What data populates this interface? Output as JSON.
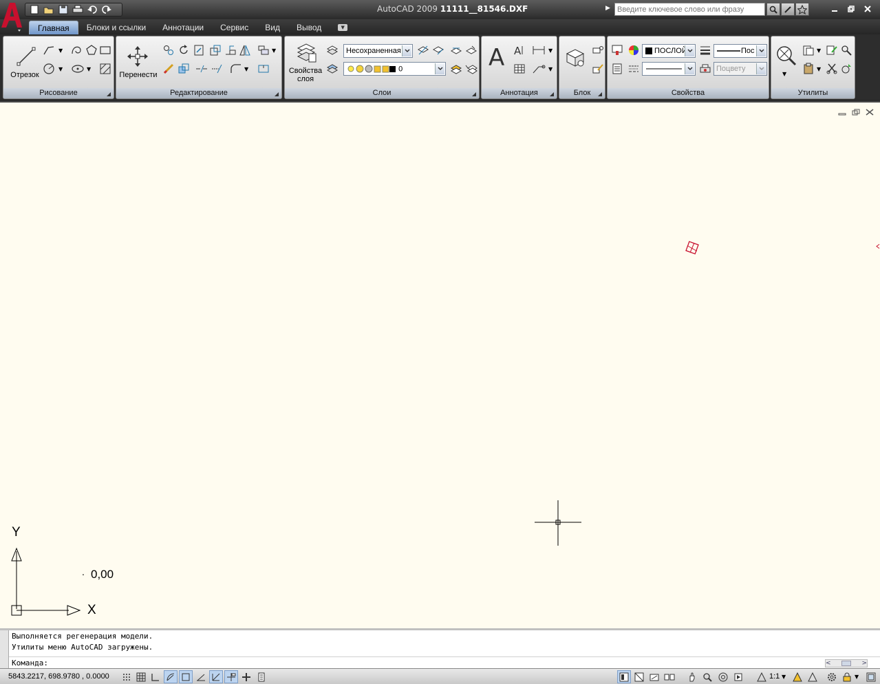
{
  "window": {
    "app_title": "AutoCAD 2009",
    "file_name": "11111__81546.DXF",
    "search_placeholder": "Введите ключевое слово или фразу"
  },
  "tabs": [
    "Главная",
    "Блоки и ссылки",
    "Аннотации",
    "Сервис",
    "Вид",
    "Вывод"
  ],
  "active_tab": "Главная",
  "panels": {
    "draw": {
      "title": "Рисование",
      "line_label": "Отрезок"
    },
    "modify": {
      "title": "Редактирование",
      "move_label": "Перенести"
    },
    "layers": {
      "title": "Слои",
      "props_label_1": "Свойства",
      "props_label_2": "слоя",
      "state_combo": "Несохраненная",
      "layer_combo": "0"
    },
    "annotation": {
      "title": "Аннотация"
    },
    "block": {
      "title": "Блок"
    },
    "properties": {
      "title": "Свойства",
      "color_combo": "ПОСЛОЙ",
      "lineweight_combo": "Пос",
      "plotstyle_combo": "Поцвету"
    },
    "utilities": {
      "title": "Утилиты"
    }
  },
  "drawing": {
    "ucs_y": "Y",
    "ucs_x": "X",
    "coord_label": "0,00",
    "coord_dot": ".",
    "background": "#fffcf0"
  },
  "command": {
    "lines": [
      "Выполняется регенерация модели.",
      "Утилиты меню AutoCAD загружены."
    ],
    "prompt": "Команда:"
  },
  "status": {
    "coordinates": "5843.2217, 698.9780 , 0.0000",
    "annotation_scale": "1:1"
  },
  "colors": {
    "accent_red": "#c8102e",
    "ribbon_tab_active": "#9ab8e0"
  }
}
